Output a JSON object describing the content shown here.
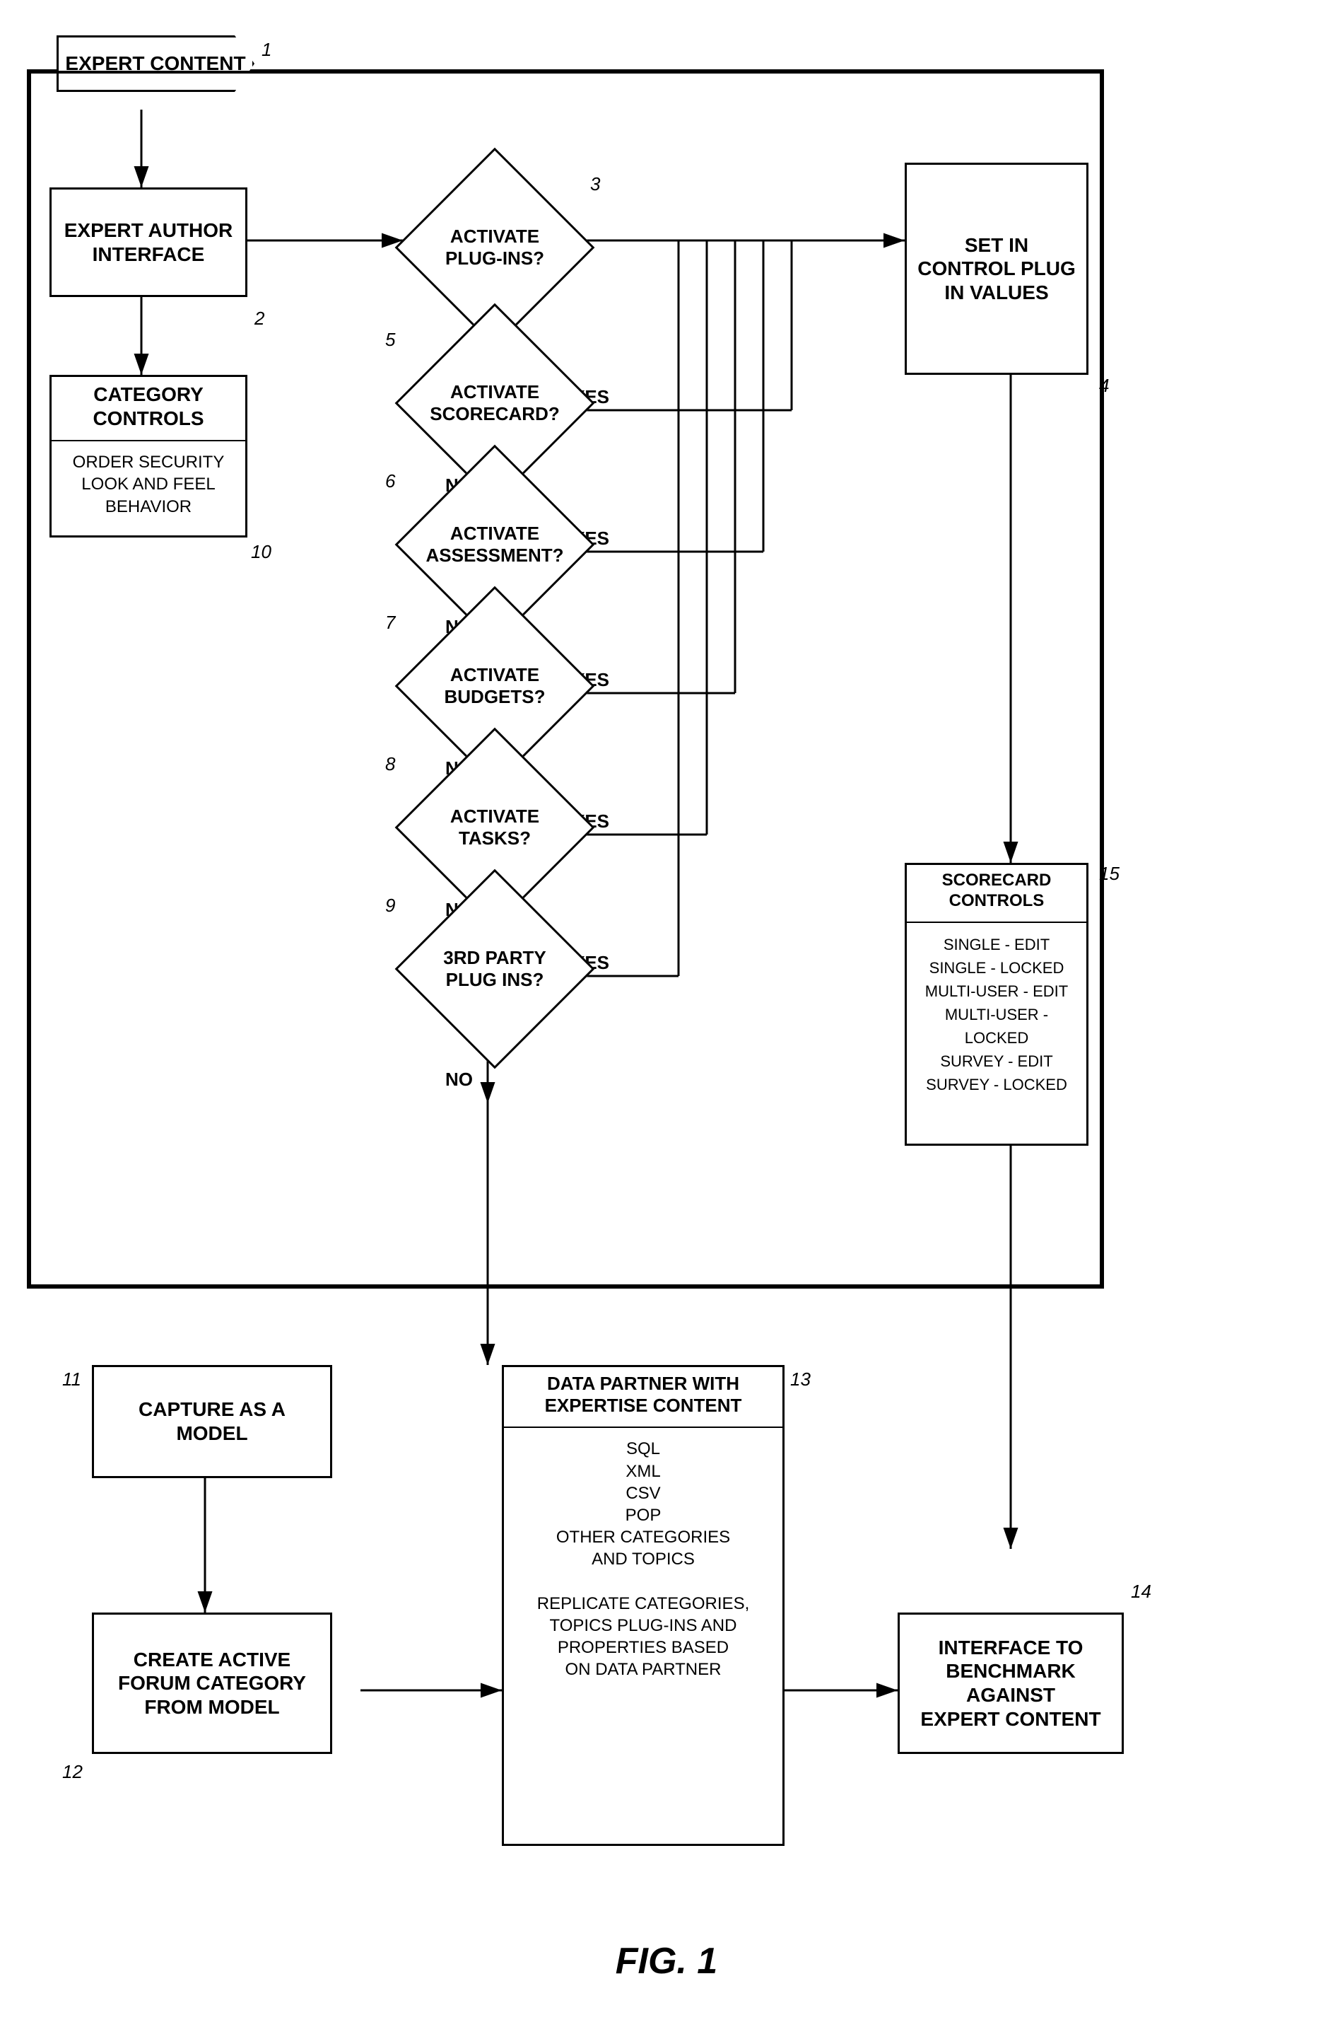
{
  "title": "FIG. 1",
  "nodes": {
    "expert_content": {
      "label": "EXPERT CONTENT",
      "num": "1"
    },
    "expert_author": {
      "label": "EXPERT AUTHOR\nINTERFACE",
      "num": "2"
    },
    "set_control": {
      "label": "SET IN CONTROL PLUG\nIN VALUES",
      "num": "4"
    },
    "category_controls_top": {
      "label": "CATEGORY CONTROLS"
    },
    "category_controls_bottom": {
      "label": "ORDER SECURITY\nLOOK AND FEEL\nBEHAVIOR",
      "num": "10"
    },
    "scorecard_controls_top": {
      "label": "SCORECARD CONTROLS",
      "num": "15"
    },
    "scorecard_controls_bottom": {
      "label": "SINGLE - EDIT\nSINGLE - LOCKED\nMULTI-USER - EDIT\nMULTI-USER - LOCKED\nSURVEY - EDIT\nSURVEY - LOCKED"
    },
    "activate_plugins": {
      "label": "ACTIVATE\nPLUG-INS?",
      "num": "3"
    },
    "activate_scorecard": {
      "label": "ACTIVATE\nSCORECARD?",
      "num": "5"
    },
    "activate_assessment": {
      "label": "ACTIVATE\nASSESSMENT?",
      "num": "6"
    },
    "activate_budgets": {
      "label": "ACTIVATE\nBUDGETS?",
      "num": "7"
    },
    "activate_tasks": {
      "label": "ACTIVATE\nTASKS?",
      "num": "8"
    },
    "third_party": {
      "label": "3RD PARTY\nPLUG INS?",
      "num": "9"
    },
    "capture_model": {
      "label": "CAPTURE AS A\nMODEL",
      "num": "11"
    },
    "create_forum": {
      "label": "CREATE ACTIVE\nFORUM CATEGORY\nFROM MODEL",
      "num": "12"
    },
    "data_partner_top": {
      "label": "DATA PARTNER WITH\nEXPERTISE CONTENT",
      "num": "13"
    },
    "data_partner_bottom": {
      "label": "SQL\nXML\nCSV\nPOP\nOTHER CATEGORIES\nAND TOPICS\n\nREPLICATE CATEGORIES,\nTOPICS PLUG-INS AND\nPROPERTIES BASED\nON DATA PARTNER"
    },
    "interface_benchmark": {
      "label": "INTERFACE TO\nBENCHMARK AGAINST\nEXPERT CONTENT",
      "num": "14"
    }
  },
  "labels": {
    "yes": "YES",
    "no": "NO",
    "fig": "FIG. 1"
  }
}
